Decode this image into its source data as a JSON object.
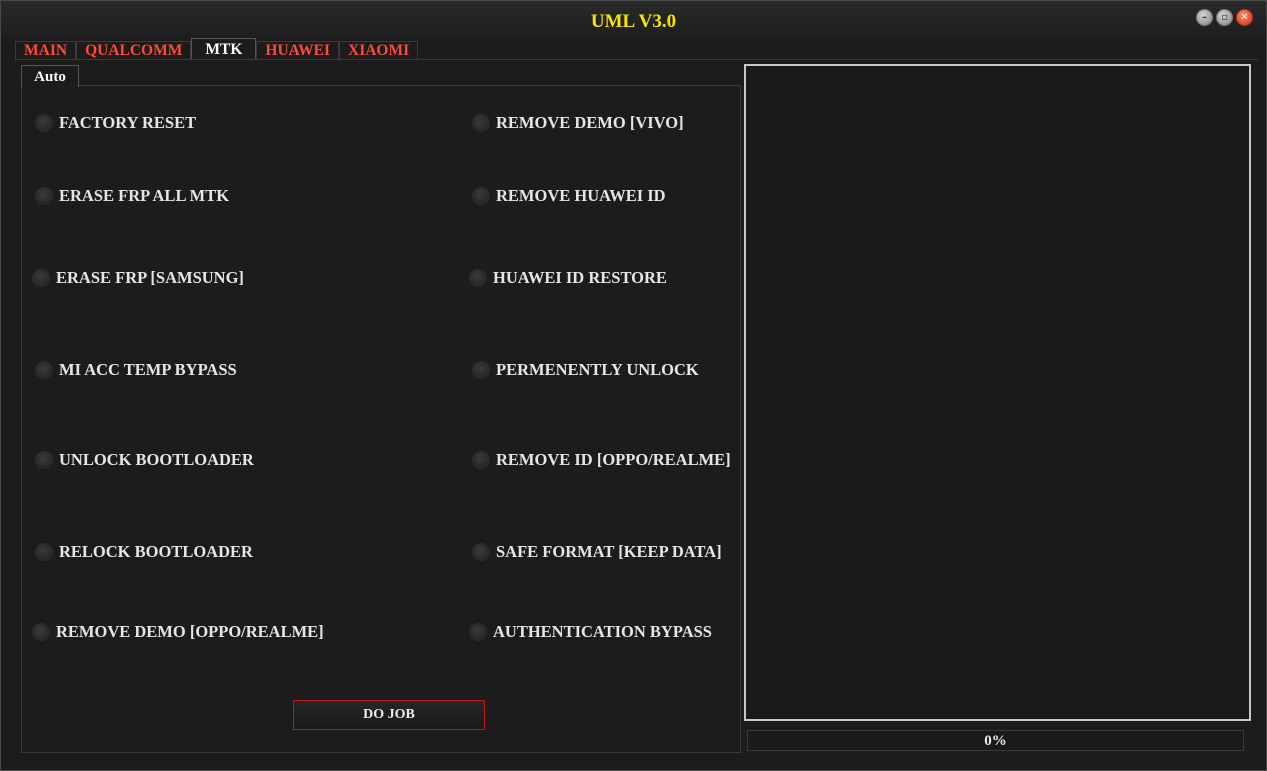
{
  "window": {
    "title": "UML V3.0",
    "title_color": "#f7e600"
  },
  "tabs": [
    {
      "label": "MAIN"
    },
    {
      "label": "QUALCOMM"
    },
    {
      "label": "MTK",
      "active": true
    },
    {
      "label": "HUAWEI"
    },
    {
      "label": "XIAOMI"
    }
  ],
  "subtab": {
    "label": "Auto"
  },
  "options": {
    "left": [
      "FACTORY RESET",
      "ERASE FRP ALL MTK",
      "ERASE FRP [SAMSUNG]",
      "MI ACC TEMP BYPASS",
      "UNLOCK BOOTLOADER",
      "RELOCK BOOTLOADER",
      "REMOVE DEMO [OPPO/REALME]"
    ],
    "right": [
      "REMOVE DEMO [VIVO]",
      "REMOVE HUAWEI ID",
      "HUAWEI ID RESTORE",
      "PERMENENTLY UNLOCK",
      "REMOVE ID [OPPO/REALME]",
      "SAFE FORMAT [KEEP DATA]",
      "AUTHENTICATION BYPASS"
    ]
  },
  "do_job_label": "DO JOB",
  "progress": {
    "text": "0%",
    "value": 0
  },
  "colors": {
    "accent_tab": "#ff4a3a",
    "button_border": "#c0131a"
  }
}
